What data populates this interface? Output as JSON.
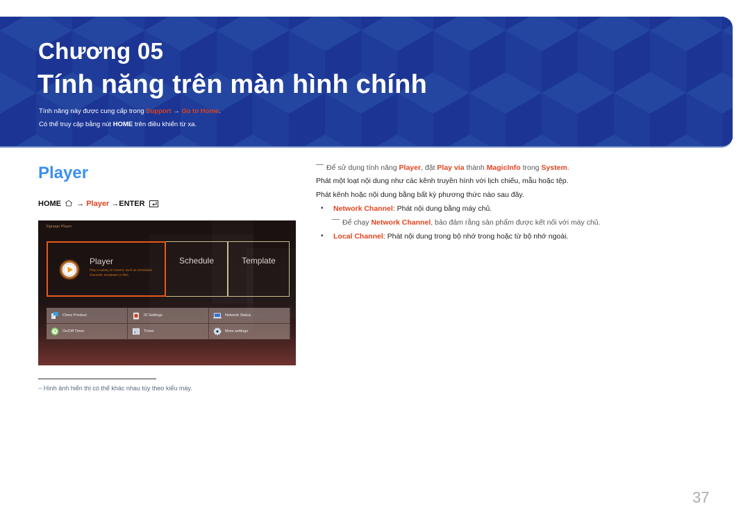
{
  "banner": {
    "chapter": "Chương 05",
    "title": "Tính năng trên màn hình chính",
    "line1": {
      "prefix": "Tính năng này được cung cấp trong ",
      "link1": "Support",
      "arrow": " → ",
      "link2": "Go to Home",
      "suffix": "."
    },
    "line2": {
      "prefix": "Có thể truy cập bằng nút ",
      "bold": "HOME",
      "suffix": " trên điều khiển từ xa."
    },
    "background_color": "#1f3c9a"
  },
  "section": {
    "title": "Player",
    "path": {
      "home": "HOME",
      "arrow1": " → ",
      "player": "Player",
      "arrow2": " →",
      "enter": "ENTER"
    }
  },
  "screen": {
    "app_name": "Signage Player",
    "tiles": [
      {
        "label": "Player",
        "description": "Play a variety of content, such as scheduled channels, templates or files.",
        "selected": true
      },
      {
        "label": "Schedule",
        "selected": false
      },
      {
        "label": "Template",
        "selected": false
      }
    ],
    "menu": [
      {
        "label": "Clone Product",
        "icon": "clone-product-icon"
      },
      {
        "label": "ID Settings",
        "icon": "id-settings-icon"
      },
      {
        "label": "Network Status",
        "icon": "network-status-icon"
      },
      {
        "label": "On/Off Timer",
        "icon": "timer-icon"
      },
      {
        "label": "Ticker",
        "icon": "ticker-icon"
      },
      {
        "label": "More settings",
        "icon": "gear-icon"
      }
    ],
    "accent_color": "#e9581e"
  },
  "footnote": "Hình ảnh hiển thị có thể khác nhau tùy theo kiểu máy.",
  "right": {
    "note1": {
      "prefix": "Để sử dụng tính năng ",
      "b1": "Player",
      "mid1": ", đặt ",
      "b2": "Play via",
      "mid2": " thành ",
      "b3": "MagicInfo",
      "mid3": " trong ",
      "b4": "System",
      "suffix": "."
    },
    "para1": "Phát một loạt nội dung như các kênh truyền hình với lịch chiếu, mẫu hoặc tệp.",
    "para2": "Phát kênh hoặc nội dung bằng bất kỳ phương thức nào sau đây.",
    "bullets": [
      {
        "term": "Network Channel",
        "text": ": Phát nội dung bằng máy chủ."
      },
      {
        "term": "Local Channel",
        "text": ": Phát nội dung trong bộ nhớ trong hoặc từ bộ nhớ ngoài."
      }
    ],
    "note2": {
      "prefix": "Để chạy ",
      "term": "Network Channel",
      "suffix": ", bảo đảm rằng sản phẩm được kết nối với máy chủ."
    },
    "accent_color": "#e2431f"
  },
  "page_number": "37"
}
